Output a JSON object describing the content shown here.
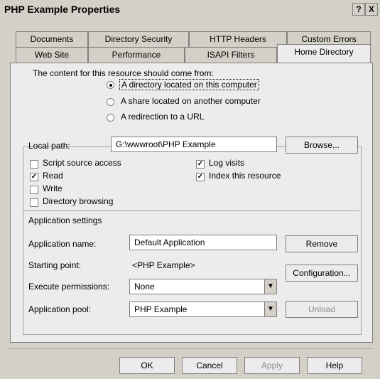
{
  "window": {
    "title": "PHP Example Properties",
    "help_label": "?",
    "close_label": "X"
  },
  "tabs_row1": [
    {
      "label": "Documents"
    },
    {
      "label": "Directory Security"
    },
    {
      "label": "HTTP Headers"
    },
    {
      "label": "Custom Errors"
    }
  ],
  "tabs_row2": [
    {
      "label": "Web Site"
    },
    {
      "label": "Performance"
    },
    {
      "label": "ISAPI Filters"
    },
    {
      "label": "Home Directory",
      "selected": true
    }
  ],
  "content": {
    "source_prompt": "The content for this resource should come from:",
    "radios": [
      {
        "label": "A directory located on this computer",
        "selected": true
      },
      {
        "label": "A share located on another computer",
        "selected": false
      },
      {
        "label": "A redirection to a URL",
        "selected": false
      }
    ],
    "local_path": {
      "label": "Local path:",
      "value": "G:\\wwwroot\\PHP Example",
      "browse_label": "Browse..."
    },
    "checkboxes": [
      {
        "label": "Script source access",
        "checked": false
      },
      {
        "label": "Read",
        "checked": true
      },
      {
        "label": "Write",
        "checked": false
      },
      {
        "label": "Directory browsing",
        "checked": false
      },
      {
        "label": "Log visits",
        "checked": true
      },
      {
        "label": "Index this resource",
        "checked": true
      }
    ],
    "app_settings": {
      "heading": "Application settings",
      "name_label": "Application name:",
      "name_value": "Default Application",
      "remove_label": "Remove",
      "start_label": "Starting point:",
      "start_value": "<PHP Example>",
      "config_label": "Configuration...",
      "exec_label": "Execute permissions:",
      "exec_value": "None",
      "pool_label": "Application pool:",
      "pool_value": "PHP Example",
      "unload_label": "Unload"
    }
  },
  "footer": {
    "ok_label": "OK",
    "cancel_label": "Cancel",
    "apply_label": "Apply",
    "help_label": "Help"
  }
}
